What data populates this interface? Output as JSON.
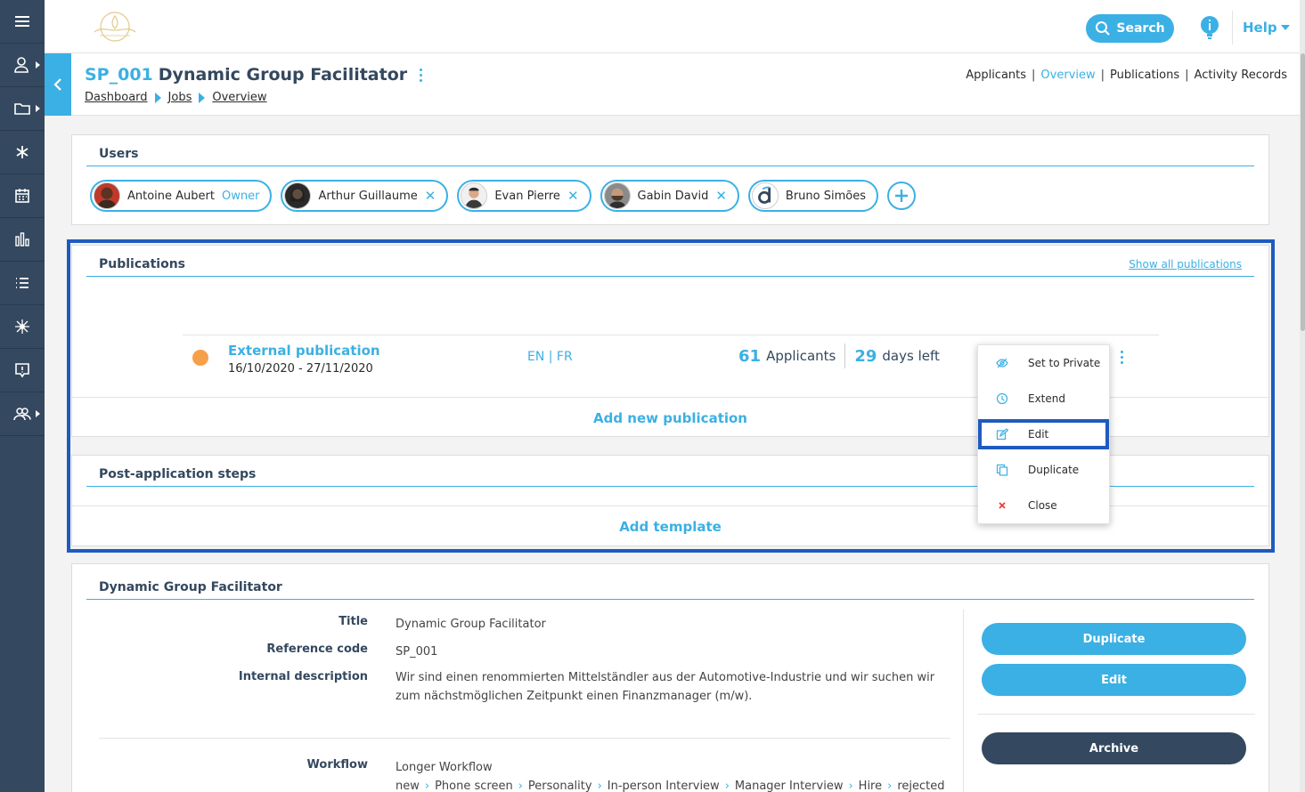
{
  "topbar": {
    "search_label": "Search",
    "help_label": "Help"
  },
  "titlebar": {
    "code": "SP_001",
    "title": "Dynamic Group Facilitator",
    "breadcrumb": [
      "Dashboard",
      "Jobs",
      "Overview"
    ],
    "tabs": [
      "Applicants",
      "Overview",
      "Publications",
      "Activity Records"
    ],
    "active_tab": "Overview"
  },
  "users": {
    "title": "Users",
    "list": [
      {
        "name": "Antoine Aubert",
        "role": "Owner"
      },
      {
        "name": "Arthur Guillaume"
      },
      {
        "name": "Evan Pierre"
      },
      {
        "name": "Gabin David"
      },
      {
        "name": "Bruno Simões"
      }
    ]
  },
  "publications": {
    "title": "Publications",
    "show_all": "Show all publications",
    "item": {
      "name": "External publication",
      "dates": "16/10/2020 - 27/11/2020",
      "languages": "EN | FR",
      "applicants_count": "61",
      "applicants_label": "Applicants",
      "days_count": "29",
      "days_label": "days left",
      "status_color": "#f7a04a"
    },
    "add_label": "Add new publication"
  },
  "dropdown": {
    "items": [
      "Set to Private",
      "Extend",
      "Edit",
      "Duplicate",
      "Close"
    ]
  },
  "steps": {
    "title": "Post-application steps",
    "add_label": "Add template"
  },
  "details": {
    "title": "Dynamic Group Facilitator",
    "labels": {
      "title": "Title",
      "reference": "Reference code",
      "internal_description": "Internal description",
      "workflow": "Workflow"
    },
    "values": {
      "title": "Dynamic Group Facilitator",
      "reference": "SP_001",
      "internal_description": "Wir sind einen renommierten Mittelständler aus der Automotive-Industrie und wir suchen wir zum nächstmöglichen Zeitpunkt einen Finanzmanager (m/w).",
      "workflow": "Longer Workflow"
    },
    "workflow_steps": [
      "new",
      "Phone screen",
      "Personality",
      "In-person Interview",
      "Manager Interview",
      "Hire",
      "rejected"
    ],
    "buttons": {
      "duplicate": "Duplicate",
      "edit": "Edit",
      "archive": "Archive"
    }
  },
  "colors": {
    "accent": "#3bb0e4",
    "sidebar": "#34485f",
    "highlight": "#1e5bbf"
  }
}
